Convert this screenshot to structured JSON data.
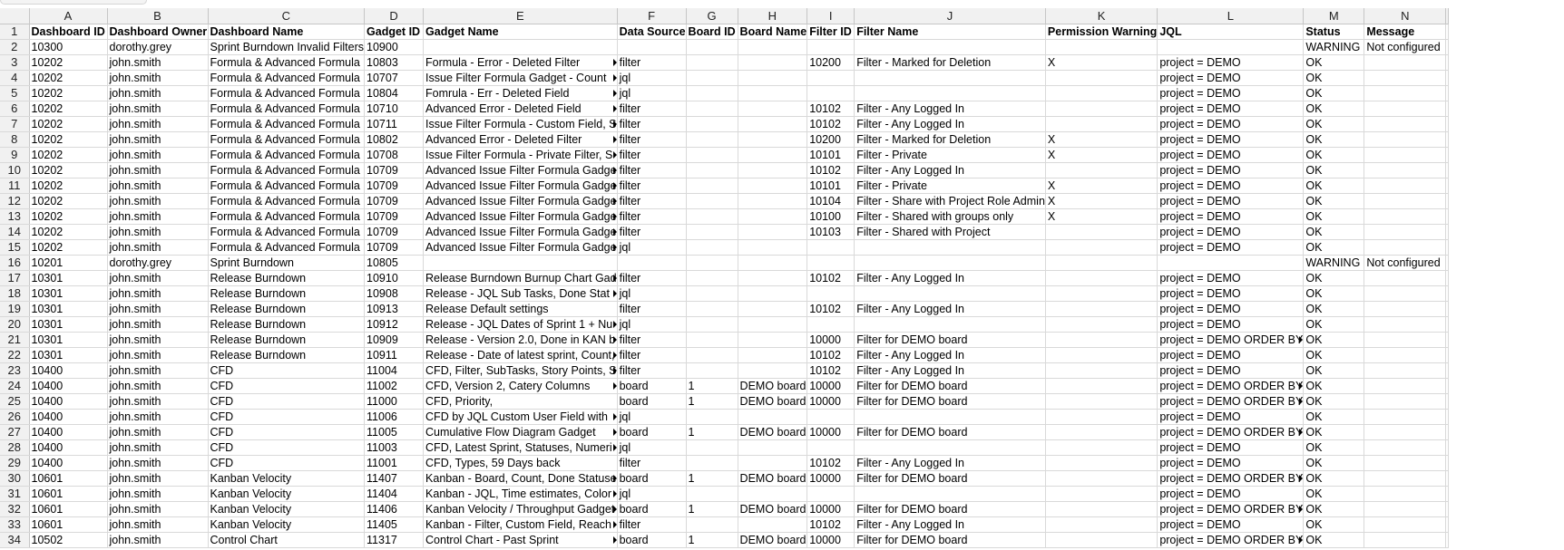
{
  "columns": [
    "A",
    "B",
    "C",
    "D",
    "E",
    "F",
    "G",
    "H",
    "I",
    "J",
    "K",
    "L",
    "M",
    "N"
  ],
  "header": [
    "Dashboard ID",
    "Dashboard Owner",
    "Dashboard Name",
    "Gadget ID",
    "Gadget Name",
    "Data Source",
    "Board ID",
    "Board Name",
    "Filter ID",
    "Filter Name",
    "Permission Warning",
    "JQL",
    "Status",
    "Message"
  ],
  "rows": [
    [
      "10300",
      "dorothy.grey",
      "Sprint Burndown Invalid Filters",
      "10900",
      "",
      "",
      "",
      "",
      "",
      "",
      "",
      "",
      "WARNING",
      "Not configured"
    ],
    [
      "10202",
      "john.smith",
      "Formula & Advanced Formula",
      "10803",
      "Formula - Error - Deleted Filter",
      "filter",
      "",
      "",
      "10200",
      "Filter - Marked for Deletion",
      "X",
      "project = DEMO",
      "OK",
      ""
    ],
    [
      "10202",
      "john.smith",
      "Formula & Advanced Formula",
      "10707",
      "Issue Filter Formula Gadget - Count",
      "jql",
      "",
      "",
      "",
      "",
      "",
      "project = DEMO",
      "OK",
      ""
    ],
    [
      "10202",
      "john.smith",
      "Formula & Advanced Formula",
      "10804",
      "Fomrula - Err - Deleted Field",
      "jql",
      "",
      "",
      "",
      "",
      "",
      "project = DEMO",
      "OK",
      ""
    ],
    [
      "10202",
      "john.smith",
      "Formula & Advanced Formula",
      "10710",
      "Advanced Error - Deleted Field",
      "filter",
      "",
      "",
      "10102",
      "Filter - Any Logged In",
      "",
      "project = DEMO",
      "OK",
      ""
    ],
    [
      "10202",
      "john.smith",
      "Formula & Advanced Formula",
      "10711",
      "Issue Filter Formula - Custom Field, S",
      "filter",
      "",
      "",
      "10102",
      "Filter - Any Logged In",
      "",
      "project = DEMO",
      "OK",
      ""
    ],
    [
      "10202",
      "john.smith",
      "Formula & Advanced Formula",
      "10802",
      "Advanced Error - Deleted Filter",
      "filter",
      "",
      "",
      "10200",
      "Filter - Marked for Deletion",
      "X",
      "project = DEMO",
      "OK",
      ""
    ],
    [
      "10202",
      "john.smith",
      "Formula & Advanced Formula",
      "10708",
      "Issue Filter Formula - Private Filter, S",
      "filter",
      "",
      "",
      "10101",
      "Filter - Private",
      "X",
      "project = DEMO",
      "OK",
      ""
    ],
    [
      "10202",
      "john.smith",
      "Formula & Advanced Formula",
      "10709",
      "Advanced Issue Filter Formula Gadge",
      "filter",
      "",
      "",
      "10102",
      "Filter - Any Logged In",
      "",
      "project = DEMO",
      "OK",
      ""
    ],
    [
      "10202",
      "john.smith",
      "Formula & Advanced Formula",
      "10709",
      "Advanced Issue Filter Formula Gadge",
      "filter",
      "",
      "",
      "10101",
      "Filter - Private",
      "X",
      "project = DEMO",
      "OK",
      ""
    ],
    [
      "10202",
      "john.smith",
      "Formula & Advanced Formula",
      "10709",
      "Advanced Issue Filter Formula Gadge",
      "filter",
      "",
      "",
      "10104",
      "Filter - Share with Project Role Admin",
      "X",
      "project = DEMO",
      "OK",
      ""
    ],
    [
      "10202",
      "john.smith",
      "Formula & Advanced Formula",
      "10709",
      "Advanced Issue Filter Formula Gadge",
      "filter",
      "",
      "",
      "10100",
      "Filter - Shared with groups only",
      "X",
      "project = DEMO",
      "OK",
      ""
    ],
    [
      "10202",
      "john.smith",
      "Formula & Advanced Formula",
      "10709",
      "Advanced Issue Filter Formula Gadge",
      "filter",
      "",
      "",
      "10103",
      "Filter - Shared with Project",
      "",
      "project = DEMO",
      "OK",
      ""
    ],
    [
      "10202",
      "john.smith",
      "Formula & Advanced Formula",
      "10709",
      "Advanced Issue Filter Formula Gadge",
      "jql",
      "",
      "",
      "",
      "",
      "",
      "project = DEMO",
      "OK",
      ""
    ],
    [
      "10201",
      "dorothy.grey",
      "Sprint Burndown",
      "10805",
      "",
      "",
      "",
      "",
      "",
      "",
      "",
      "",
      "WARNING",
      "Not configured"
    ],
    [
      "10301",
      "john.smith",
      "Release Burndown",
      "10910",
      "Release Burndown Burnup Chart Gad",
      "filter",
      "",
      "",
      "10102",
      "Filter - Any Logged In",
      "",
      "project = DEMO",
      "OK",
      ""
    ],
    [
      "10301",
      "john.smith",
      "Release Burndown",
      "10908",
      "Release - JQL Sub Tasks, Done Stat",
      "jql",
      "",
      "",
      "",
      "",
      "",
      "project = DEMO",
      "OK",
      ""
    ],
    [
      "10301",
      "john.smith",
      "Release Burndown",
      "10913",
      "Release Default settings",
      "filter",
      "",
      "",
      "10102",
      "Filter - Any Logged In",
      "",
      "project = DEMO",
      "OK",
      ""
    ],
    [
      "10301",
      "john.smith",
      "Release Burndown",
      "10912",
      "Release - JQL Dates of Sprint 1 + Nu",
      "jql",
      "",
      "",
      "",
      "",
      "",
      "project = DEMO",
      "OK",
      ""
    ],
    [
      "10301",
      "john.smith",
      "Release Burndown",
      "10909",
      "Release - Version 2.0, Done in KAN b",
      "filter",
      "",
      "",
      "10000",
      "Filter for DEMO board",
      "",
      "project = DEMO ORDER BY",
      "OK",
      ""
    ],
    [
      "10301",
      "john.smith",
      "Release Burndown",
      "10911",
      "Release - Date of latest sprint, Count,",
      "filter",
      "",
      "",
      "10102",
      "Filter - Any Logged In",
      "",
      "project = DEMO",
      "OK",
      ""
    ],
    [
      "10400",
      "john.smith",
      "CFD",
      "11004",
      "CFD, Filter, SubTasks, Story Points, S",
      "filter",
      "",
      "",
      "10102",
      "Filter - Any Logged In",
      "",
      "project = DEMO",
      "OK",
      ""
    ],
    [
      "10400",
      "john.smith",
      "CFD",
      "11002",
      "CFD, Version 2, Catery Columns",
      "board",
      "1",
      "DEMO board",
      "10000",
      "Filter for DEMO board",
      "",
      "project = DEMO ORDER BY",
      "OK",
      ""
    ],
    [
      "10400",
      "john.smith",
      "CFD",
      "11000",
      "CFD, Priority,",
      "board",
      "1",
      "DEMO board",
      "10000",
      "Filter for DEMO board",
      "",
      "project = DEMO ORDER BY",
      "OK",
      ""
    ],
    [
      "10400",
      "john.smith",
      "CFD",
      "11006",
      "CFD by  JQL Custom User Field with",
      "jql",
      "",
      "",
      "",
      "",
      "",
      "project = DEMO",
      "OK",
      ""
    ],
    [
      "10400",
      "john.smith",
      "CFD",
      "11005",
      "Cumulative Flow Diagram Gadget",
      "board",
      "1",
      "DEMO board",
      "10000",
      "Filter for DEMO board",
      "",
      "project = DEMO ORDER BY",
      "OK",
      ""
    ],
    [
      "10400",
      "john.smith",
      "CFD",
      "11003",
      "CFD, Latest Sprint, Statuses, Numeri",
      "jql",
      "",
      "",
      "",
      "",
      "",
      "project = DEMO",
      "OK",
      ""
    ],
    [
      "10400",
      "john.smith",
      "CFD",
      "11001",
      "CFD, Types, 59 Days back",
      "filter",
      "",
      "",
      "10102",
      "Filter - Any Logged In",
      "",
      "project = DEMO",
      "OK",
      ""
    ],
    [
      "10601",
      "john.smith",
      "Kanban Velocity",
      "11407",
      "Kanban - Board, Count, Done Statuse",
      "board",
      "1",
      "DEMO board",
      "10000",
      "Filter for DEMO board",
      "",
      "project = DEMO ORDER BY",
      "OK",
      ""
    ],
    [
      "10601",
      "john.smith",
      "Kanban Velocity",
      "11404",
      "Kanban - JQL, Time estimates, Color",
      "jql",
      "",
      "",
      "",
      "",
      "",
      "project = DEMO",
      "OK",
      ""
    ],
    [
      "10601",
      "john.smith",
      "Kanban Velocity",
      "11406",
      "Kanban Velocity / Throughput Gadget",
      "board",
      "1",
      "DEMO board",
      "10000",
      "Filter for DEMO board",
      "",
      "project = DEMO ORDER BY",
      "OK",
      ""
    ],
    [
      "10601",
      "john.smith",
      "Kanban Velocity",
      "11405",
      "Kanban - Filter, Custom Field, Reach",
      "filter",
      "",
      "",
      "10102",
      "Filter - Any Logged In",
      "",
      "project = DEMO",
      "OK",
      ""
    ],
    [
      "10502",
      "john.smith",
      "Control Chart",
      "11317",
      "Control Chart - Past Sprint",
      "board",
      "1",
      "DEMO board",
      "10000",
      "Filter for DEMO board",
      "",
      "project = DEMO ORDER BY",
      "OK",
      ""
    ]
  ],
  "colors": {
    "header_bg": "#f1f1f1",
    "grid": "#d9d9d9"
  }
}
